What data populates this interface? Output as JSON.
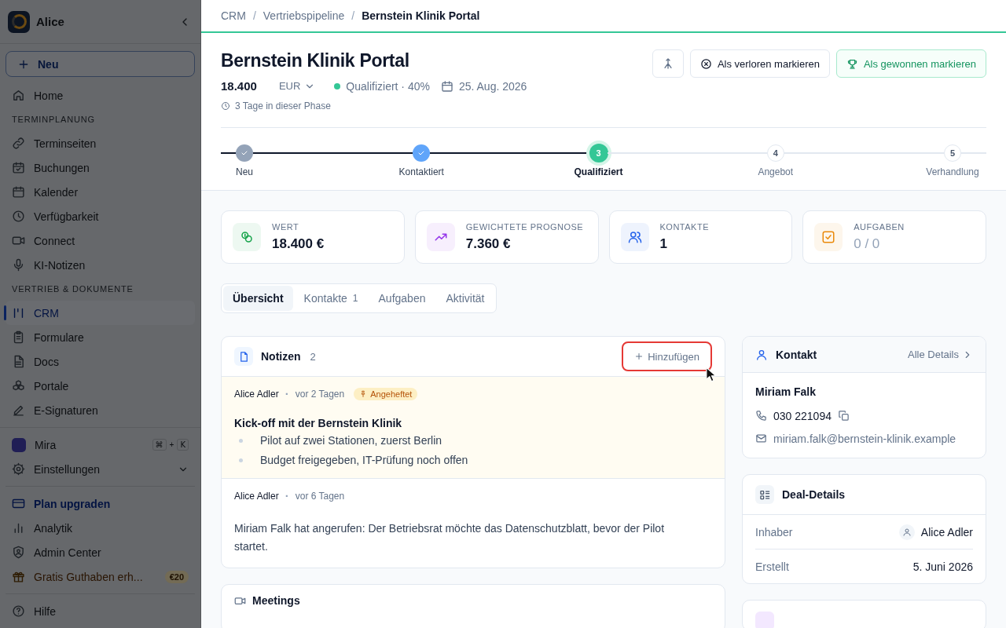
{
  "sidebar": {
    "workspace": "Alice",
    "new_button": "Neu",
    "items": [
      {
        "kind": "item",
        "label": "Home",
        "selected": false
      },
      {
        "kind": "section",
        "label": "TERMINPLANUNG"
      },
      {
        "kind": "item",
        "label": "Terminseiten",
        "selected": false
      },
      {
        "kind": "item",
        "label": "Buchungen",
        "selected": false
      },
      {
        "kind": "item",
        "label": "Kalender",
        "selected": false
      },
      {
        "kind": "item",
        "label": "Verfügbarkeit",
        "selected": false
      },
      {
        "kind": "item",
        "label": "Connect",
        "selected": false
      },
      {
        "kind": "item",
        "label": "KI-Notizen",
        "selected": false
      },
      {
        "kind": "section",
        "label": "VERTRIEB & DOKUMENTE"
      },
      {
        "kind": "item",
        "label": "CRM",
        "selected": true
      },
      {
        "kind": "item",
        "label": "Formulare",
        "selected": false
      },
      {
        "kind": "item",
        "label": "Docs",
        "selected": false
      },
      {
        "kind": "item",
        "label": "Portale",
        "selected": false
      },
      {
        "kind": "item",
        "label": "E-Signaturen",
        "selected": false
      }
    ],
    "footer": [
      {
        "kind": "assistant",
        "label": "Mira",
        "keys": [
          "⌘",
          "+",
          "K"
        ]
      },
      {
        "kind": "expandable",
        "label": "Einstellungen",
        "expanded": false
      },
      {
        "kind": "divider"
      },
      {
        "kind": "upgrade",
        "label": "Plan upgraden"
      },
      {
        "kind": "item",
        "label": "Analytik"
      },
      {
        "kind": "item",
        "label": "Admin Center"
      },
      {
        "kind": "promo",
        "label": "Gratis Guthaben erh...",
        "badge": "€20"
      },
      {
        "kind": "divider"
      },
      {
        "kind": "item",
        "label": "Hilfe"
      }
    ]
  },
  "breadcrumb": {
    "separator": "/",
    "items": [
      "CRM",
      "Vertriebspipeline",
      "Bernstein Klinik Portal"
    ]
  },
  "deal": {
    "title": "Bernstein Klinik Portal",
    "amount": "18.400",
    "currency": "EUR",
    "stage": "Qualifiziert · 40%",
    "date": "25. Aug. 2026",
    "phase_age": "3 Tage in dieser Phase"
  },
  "actions": [
    {
      "kind": "icon"
    },
    {
      "kind": "lost",
      "label": "Als verloren markieren"
    },
    {
      "kind": "won",
      "label": "Als gewonnen markieren"
    }
  ],
  "steps": [
    {
      "label": "Neu",
      "completed": true,
      "selected": false,
      "color": "#94a3b8"
    },
    {
      "label": "Kontaktiert",
      "completed": true,
      "selected": false,
      "color": "#60a5fa"
    },
    {
      "label": "Qualifiziert",
      "completed": false,
      "selected": true,
      "number": "3",
      "color": "#34c796"
    },
    {
      "label": "Angebot",
      "completed": false,
      "selected": false,
      "number": "4"
    },
    {
      "label": "Verhandlung",
      "completed": false,
      "selected": false,
      "number": "5"
    }
  ],
  "stats": [
    {
      "label": "WERT",
      "value": "18.400 €",
      "color": "#16a34a",
      "muted": false
    },
    {
      "label": "GEWICHTETE PROGNOSE",
      "value": "7.360 €",
      "color": "#9333ea",
      "muted": false
    },
    {
      "label": "KONTAKTE",
      "value": "1",
      "color": "#2563eb",
      "muted": false
    },
    {
      "label": "AUFGABEN",
      "value": "0 / 0",
      "color": "#ea8a0c",
      "muted": true
    }
  ],
  "tabs": [
    {
      "label": "Übersicht",
      "selected": true
    },
    {
      "label": "Kontakte",
      "count": "1",
      "selected": false
    },
    {
      "label": "Aufgaben",
      "selected": false
    },
    {
      "label": "Aktivität",
      "selected": false
    }
  ],
  "notes": {
    "title": "Notizen",
    "count": "2",
    "add_button": "Hinzufügen",
    "highlighted": true,
    "separator": "·",
    "entries": [
      {
        "author": "Alice Adler",
        "time": "vor 2 Tagen",
        "pinned": true,
        "pin_label": "Angeheftet",
        "title": "Kick-off mit der Bernstein Klinik",
        "bullets": [
          "Pilot auf zwei Stationen, zuerst Berlin",
          "Budget freigegeben, IT-Prüfung noch offen"
        ]
      },
      {
        "author": "Alice Adler",
        "time": "vor 6 Tagen",
        "pinned": false,
        "text": "Miriam Falk hat angerufen: Der Betriebsrat möchte das Datenschutzblatt, bevor der Pilot startet."
      }
    ]
  },
  "meetings": {
    "title": "Meetings"
  },
  "contact": {
    "title": "Kontakt",
    "link": "Alle Details",
    "name": "Miriam Falk",
    "phone": "030 221094",
    "email": "miriam.falk@bernstein-klinik.example"
  },
  "deal_details": {
    "title": "Deal-Details",
    "rows": [
      {
        "kind": "person",
        "label": "Inhaber",
        "value": "Alice Adler"
      },
      {
        "kind": "text",
        "label": "Erstellt",
        "value": "5. Juni 2026"
      }
    ]
  }
}
